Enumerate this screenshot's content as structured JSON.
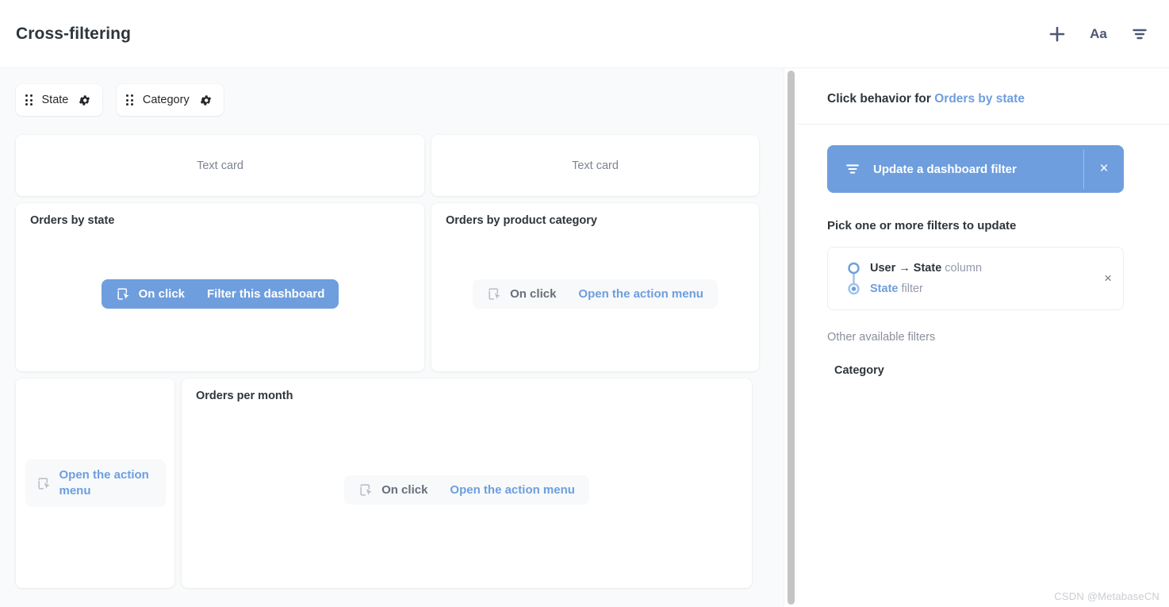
{
  "header": {
    "title": "Cross-filtering",
    "actions": [
      {
        "name": "add-icon",
        "label": "+"
      },
      {
        "name": "text-format-icon",
        "label": "Aa"
      },
      {
        "name": "filter-icon",
        "label": ""
      }
    ]
  },
  "dashboard": {
    "filter_widgets": [
      {
        "label": "State"
      },
      {
        "label": "Category"
      }
    ],
    "cards": [
      {
        "title": "",
        "placeholder": "Text card",
        "kind": "text"
      },
      {
        "title": "",
        "placeholder": "Text card",
        "kind": "text"
      },
      {
        "title": "Orders by state",
        "click_label": "On click",
        "click_value": "Filter this dashboard",
        "kind": "question",
        "active": true
      },
      {
        "title": "Orders by product category",
        "click_label": "On click",
        "click_value": "Open the action menu",
        "kind": "question",
        "active": false
      },
      {
        "title": "",
        "click_label": "",
        "click_value": "Open the action menu",
        "kind": "question",
        "active": false
      },
      {
        "title": "Orders per month",
        "click_label": "On click",
        "click_value": "Open the action menu",
        "kind": "question",
        "active": false
      }
    ]
  },
  "sidebar": {
    "header_prefix": "Click behavior for ",
    "header_target": "Orders by state",
    "action_bar": {
      "label": "Update a dashboard filter",
      "close_label": "×"
    },
    "pick_title": "Pick one or more filters to update",
    "selected_filter": {
      "column_strong": "User → State",
      "column_suffix": " column",
      "filter_strong": "State",
      "filter_suffix": " filter",
      "close_label": "×"
    },
    "other_title": "Other available filters",
    "other_filters": [
      {
        "label": "Category"
      }
    ]
  },
  "watermark": "CSDN @MetabaseCN",
  "colors": {
    "accent_blue": "#6e9ede",
    "text_dark": "#2e353b",
    "text_muted": "#949aab",
    "canvas": "#f9fafb"
  }
}
